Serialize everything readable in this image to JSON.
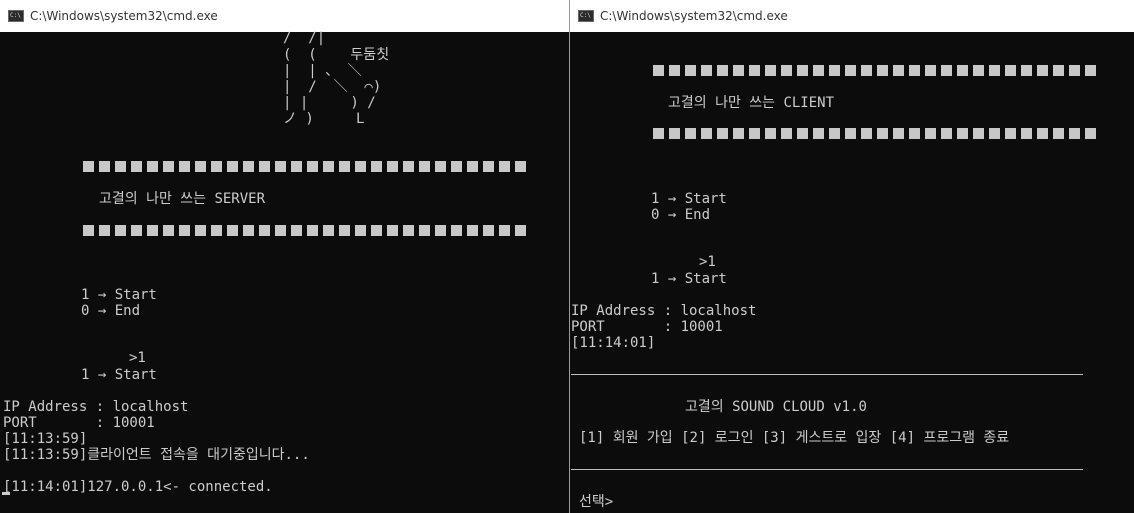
{
  "left_window": {
    "title": "C:\\Windows\\system32\\cmd.exe",
    "art": [
      "/  /|",
      "(  (    두둠칫",
      "|  | 、 ＼",
      "|  /  ＼  ⌒)",
      "| |     ) /",
      "ノ )     L"
    ],
    "banner_text": "고결의 나만 쓰는 SERVER",
    "menu_start": "1 → Start",
    "menu_end": "0 → End",
    "prompt_input": ">1",
    "selected": "1 → Start",
    "ip_line": "IP Address : localhost",
    "port_line": "PORT       : 10001",
    "time_line": "[11:13:59]",
    "waiting_line": "[11:13:59]클라이언트 접속을 대기중입니다...",
    "connected_line": "[11:14:01]127.0.0.1<- connected."
  },
  "right_window": {
    "title": "C:\\Windows\\system32\\cmd.exe",
    "banner_text": "고결의 나만 쓰는 CLIENT",
    "menu_start": "1 → Start",
    "menu_end": "0 → End",
    "prompt_input": ">1",
    "selected": "1 → Start",
    "ip_line": "IP Address : localhost",
    "port_line": "PORT       : 10001",
    "time_line": "[11:14:01]",
    "app_title": "고결의 SOUND CLOUD v1.0",
    "options": "[1] 회원 가입 [2] 로그인 [3] 게스트로 입장 [4] 프로그램 종료",
    "select_prompt": "선택>"
  }
}
